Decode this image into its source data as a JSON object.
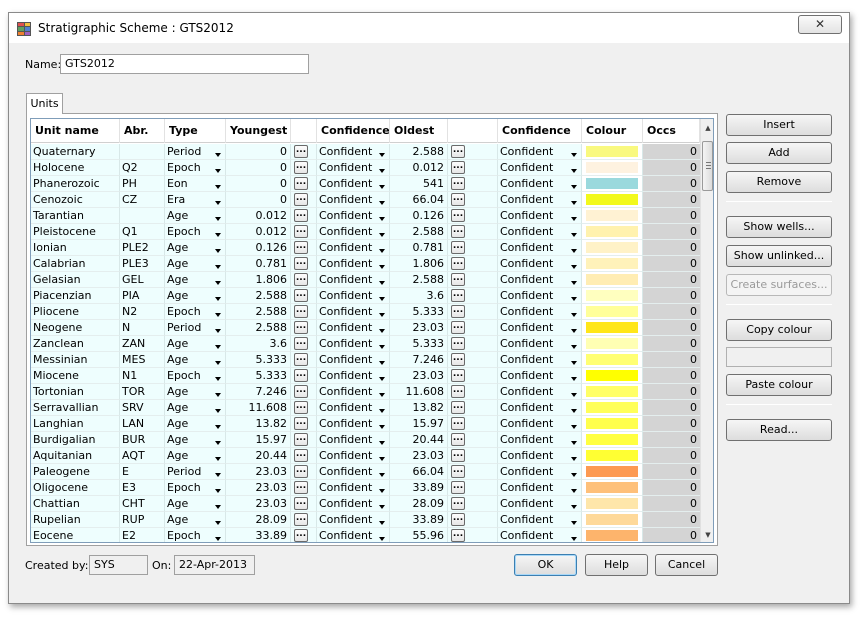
{
  "window": {
    "title": "Stratigraphic Scheme : GTS2012",
    "close_label": "✕"
  },
  "name_label": "Name:",
  "name_value": "GTS2012",
  "tabs": [
    {
      "label": "Units"
    }
  ],
  "columns": [
    "Unit name",
    "Abr.",
    "Type",
    "Youngest",
    "",
    "Confidence",
    "Oldest",
    "",
    "Confidence",
    "Colour",
    "Occs"
  ],
  "ellipsis_label": "...",
  "rows": [
    {
      "name": "Quaternary",
      "abr": "",
      "type": "Period",
      "youngest": "0",
      "conf_y": "Confident",
      "oldest": "2.588",
      "conf_o": "Confident",
      "colour": "#F9F97F",
      "occs": "0"
    },
    {
      "name": "Holocene",
      "abr": "Q2",
      "type": "Epoch",
      "youngest": "0",
      "conf_y": "Confident",
      "oldest": "0.012",
      "conf_o": "Confident",
      "colour": "#FEF2E0",
      "occs": "0"
    },
    {
      "name": "Phanerozoic",
      "abr": "PH",
      "type": "Eon",
      "youngest": "0",
      "conf_y": "Confident",
      "oldest": "541",
      "conf_o": "Confident",
      "colour": "#9AD9DD",
      "occs": "0"
    },
    {
      "name": "Cenozoic",
      "abr": "CZ",
      "type": "Era",
      "youngest": "0",
      "conf_y": "Confident",
      "oldest": "66.04",
      "conf_o": "Confident",
      "colour": "#F2F91D",
      "occs": "0"
    },
    {
      "name": "Tarantian",
      "abr": "",
      "type": "Age",
      "youngest": "0.012",
      "conf_y": "Confident",
      "oldest": "0.126",
      "conf_o": "Confident",
      "colour": "#FFF2D3",
      "occs": "0"
    },
    {
      "name": "Pleistocene",
      "abr": "Q1",
      "type": "Epoch",
      "youngest": "0.012",
      "conf_y": "Confident",
      "oldest": "2.588",
      "conf_o": "Confident",
      "colour": "#FFF2AE",
      "occs": "0"
    },
    {
      "name": "Ionian",
      "abr": "PLE2",
      "type": "Age",
      "youngest": "0.126",
      "conf_y": "Confident",
      "oldest": "0.781",
      "conf_o": "Confident",
      "colour": "#FFF2C7",
      "occs": "0"
    },
    {
      "name": "Calabrian",
      "abr": "PLE3",
      "type": "Age",
      "youngest": "0.781",
      "conf_y": "Confident",
      "oldest": "1.806",
      "conf_o": "Confident",
      "colour": "#FFF2BA",
      "occs": "0"
    },
    {
      "name": "Gelasian",
      "abr": "GEL",
      "type": "Age",
      "youngest": "1.806",
      "conf_y": "Confident",
      "oldest": "2.588",
      "conf_o": "Confident",
      "colour": "#FFEDB3",
      "occs": "0"
    },
    {
      "name": "Piacenzian",
      "abr": "PIA",
      "type": "Age",
      "youngest": "2.588",
      "conf_y": "Confident",
      "oldest": "3.6",
      "conf_o": "Confident",
      "colour": "#FFFFBF",
      "occs": "0"
    },
    {
      "name": "Pliocene",
      "abr": "N2",
      "type": "Epoch",
      "youngest": "2.588",
      "conf_y": "Confident",
      "oldest": "5.333",
      "conf_o": "Confident",
      "colour": "#FFFF99",
      "occs": "0"
    },
    {
      "name": "Neogene",
      "abr": "N",
      "type": "Period",
      "youngest": "2.588",
      "conf_y": "Confident",
      "oldest": "23.03",
      "conf_o": "Confident",
      "colour": "#FFE619",
      "occs": "0"
    },
    {
      "name": "Zanclean",
      "abr": "ZAN",
      "type": "Age",
      "youngest": "3.6",
      "conf_y": "Confident",
      "oldest": "5.333",
      "conf_o": "Confident",
      "colour": "#FFFFB3",
      "occs": "0"
    },
    {
      "name": "Messinian",
      "abr": "MES",
      "type": "Age",
      "youngest": "5.333",
      "conf_y": "Confident",
      "oldest": "7.246",
      "conf_o": "Confident",
      "colour": "#FFFF73",
      "occs": "0"
    },
    {
      "name": "Miocene",
      "abr": "N1",
      "type": "Epoch",
      "youngest": "5.333",
      "conf_y": "Confident",
      "oldest": "23.03",
      "conf_o": "Confident",
      "colour": "#FFFF00",
      "occs": "0"
    },
    {
      "name": "Tortonian",
      "abr": "TOR",
      "type": "Age",
      "youngest": "7.246",
      "conf_y": "Confident",
      "oldest": "11.608",
      "conf_o": "Confident",
      "colour": "#FFFF66",
      "occs": "0"
    },
    {
      "name": "Serravallian",
      "abr": "SRV",
      "type": "Age",
      "youngest": "11.608",
      "conf_y": "Confident",
      "oldest": "13.82",
      "conf_o": "Confident",
      "colour": "#FFFF59",
      "occs": "0"
    },
    {
      "name": "Langhian",
      "abr": "LAN",
      "type": "Age",
      "youngest": "13.82",
      "conf_y": "Confident",
      "oldest": "15.97",
      "conf_o": "Confident",
      "colour": "#FFFF4D",
      "occs": "0"
    },
    {
      "name": "Burdigalian",
      "abr": "BUR",
      "type": "Age",
      "youngest": "15.97",
      "conf_y": "Confident",
      "oldest": "20.44",
      "conf_o": "Confident",
      "colour": "#FFFF41",
      "occs": "0"
    },
    {
      "name": "Aquitanian",
      "abr": "AQT",
      "type": "Age",
      "youngest": "20.44",
      "conf_y": "Confident",
      "oldest": "23.03",
      "conf_o": "Confident",
      "colour": "#FFFF33",
      "occs": "0"
    },
    {
      "name": "Paleogene",
      "abr": "E",
      "type": "Period",
      "youngest": "23.03",
      "conf_y": "Confident",
      "oldest": "66.04",
      "conf_o": "Confident",
      "colour": "#FD9A52",
      "occs": "0"
    },
    {
      "name": "Oligocene",
      "abr": "E3",
      "type": "Epoch",
      "youngest": "23.03",
      "conf_y": "Confident",
      "oldest": "33.89",
      "conf_o": "Confident",
      "colour": "#FEC07A",
      "occs": "0"
    },
    {
      "name": "Chattian",
      "abr": "CHT",
      "type": "Age",
      "youngest": "23.03",
      "conf_y": "Confident",
      "oldest": "28.09",
      "conf_o": "Confident",
      "colour": "#FEE6AA",
      "occs": "0"
    },
    {
      "name": "Rupelian",
      "abr": "RUP",
      "type": "Age",
      "youngest": "28.09",
      "conf_y": "Confident",
      "oldest": "33.89",
      "conf_o": "Confident",
      "colour": "#FED99A",
      "occs": "0"
    },
    {
      "name": "Eocene",
      "abr": "E2",
      "type": "Epoch",
      "youngest": "33.89",
      "conf_y": "Confident",
      "oldest": "55.96",
      "conf_o": "Confident",
      "colour": "#FDB46C",
      "occs": "0"
    }
  ],
  "side_buttons": {
    "insert": "Insert",
    "add": "Add",
    "remove": "Remove",
    "show_wells": "Show wells...",
    "show_unlinked": "Show unlinked...",
    "create_surfaces": "Create surfaces...",
    "copy_colour": "Copy colour",
    "paste_colour": "Paste colour",
    "read": "Read..."
  },
  "footer": {
    "created_by_label": "Created by:",
    "created_by_value": "SYS",
    "on_label": "On:",
    "on_value": "22-Apr-2013",
    "ok": "OK",
    "help": "Help",
    "cancel": "Cancel"
  },
  "icons": {
    "app": "stratigraphy-grid-icon",
    "dropdown": "chevron-down-icon",
    "scroll_up": "arrow-up-icon",
    "scroll_down": "arrow-down-icon"
  }
}
